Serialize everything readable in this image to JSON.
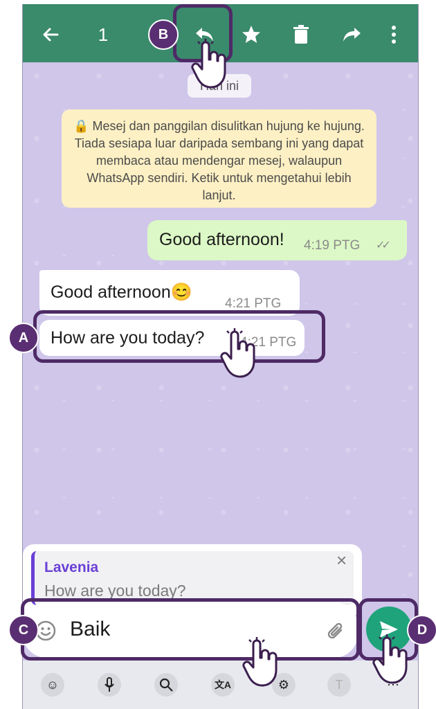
{
  "toolbar": {
    "selected_count": "1",
    "back_icon": "arrow-left-icon",
    "reply_icon": "reply-icon",
    "star_icon": "star-icon",
    "delete_icon": "trash-icon",
    "forward_icon": "forward-icon",
    "more_icon": "more-vertical-icon"
  },
  "chat": {
    "date_chip": "Hari ini",
    "encryption_notice": "🔒 Mesej dan panggilan disulitkan hujung ke hujung. Tiada sesiapa luar daripada sembang ini yang dapat membaca atau mendengar mesej, walaupun WhatsApp sendiri. Ketik untuk mengetahui lebih lanjut.",
    "messages": [
      {
        "text": "Good afternoon!",
        "time": "4:19 PTG",
        "ticks": "✓✓"
      },
      {
        "text": "Good afternoon😊",
        "time": "4:21 PTG"
      },
      {
        "text": "How are you today?",
        "time": "4:21 PTG"
      }
    ]
  },
  "reply": {
    "author": "Lavenia",
    "quoted_text": "How are you today?",
    "close": "×"
  },
  "composer": {
    "value": "Baik",
    "emoji_icon": "emoji-icon",
    "attach_icon": "paperclip-icon",
    "send_icon": "send-icon"
  },
  "badges": {
    "a": "A",
    "b": "B",
    "c": "C",
    "d": "D"
  },
  "keyboard_toolbar": [
    "emoji-icon",
    "mic-icon",
    "search-icon",
    "translate-icon",
    "settings-icon",
    "handwriting-icon",
    "more-icon"
  ]
}
